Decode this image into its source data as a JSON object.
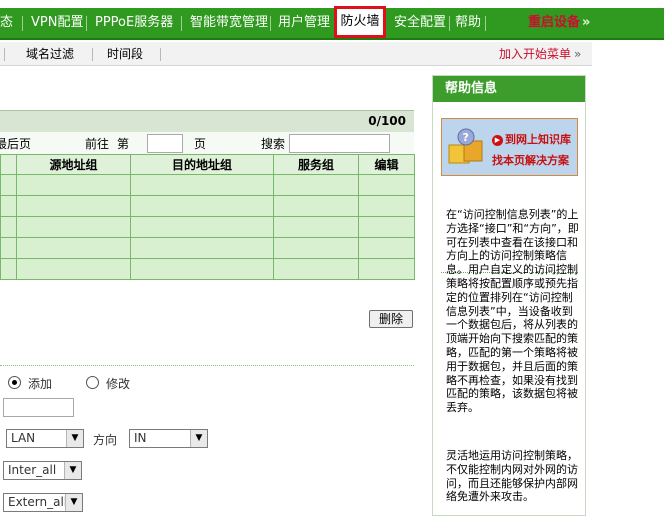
{
  "nav": {
    "items": [
      "态",
      "VPN配置",
      "PPPoE服务器",
      "智能带宽管理",
      "用户管理",
      "防火墙",
      "安全配置",
      "帮助"
    ],
    "active": "防火墙",
    "restart_label": "重启设备",
    "restart_arrow": "»"
  },
  "subnav": {
    "items": [
      "域名过滤",
      "时间段"
    ],
    "add_start_label": "加入开始菜单",
    "add_start_arrow": "»"
  },
  "table": {
    "count": "0/100",
    "pager": {
      "last_page": "最后页",
      "goto_prefix": "前往",
      "goto_di": "第",
      "page_suffix": "页",
      "search_label": "搜索"
    },
    "columns": [
      "",
      "源地址组",
      "目的地址组",
      "服务组",
      "编辑"
    ],
    "rows": 5
  },
  "delete_label": "删除",
  "form": {
    "mode_add": "添加",
    "mode_edit": "修改",
    "interface_value": "LAN",
    "direction_label": "方向",
    "direction_value": "IN",
    "src_group_value": "Inter_all",
    "dst_group_value": "Extern_all"
  },
  "help": {
    "title": "帮助信息",
    "kb_line1": "到网上知识库",
    "kb_line2": "找本页解决方案",
    "para1": "在“访问控制信息列表”的上方选择“接口”和“方向”，即可在列表中查看在该接口和方向上的访问控制策略信息。用户自定义的访问控制策略将按配置顺序或预先指定的位置排列在“访问控制信息列表”中，当设备收到一个数据包后，将从列表的顶端开始向下搜索匹配的策略，匹配的第一个策略将被用于数据包，并且后面的策略不再检查，如果没有找到匹配的策略，该数据包将被丢弃。",
    "para2": "灵活地运用访问控制策略，不仅能控制内网对外网的访问，而且还能够保护内部网络免遭外来攻击。"
  },
  "colors": {
    "nav_green": "#2f9a1f",
    "active_outline": "#e0101a",
    "restart_red": "#c8102e",
    "table_green": "#d8f0d0"
  }
}
